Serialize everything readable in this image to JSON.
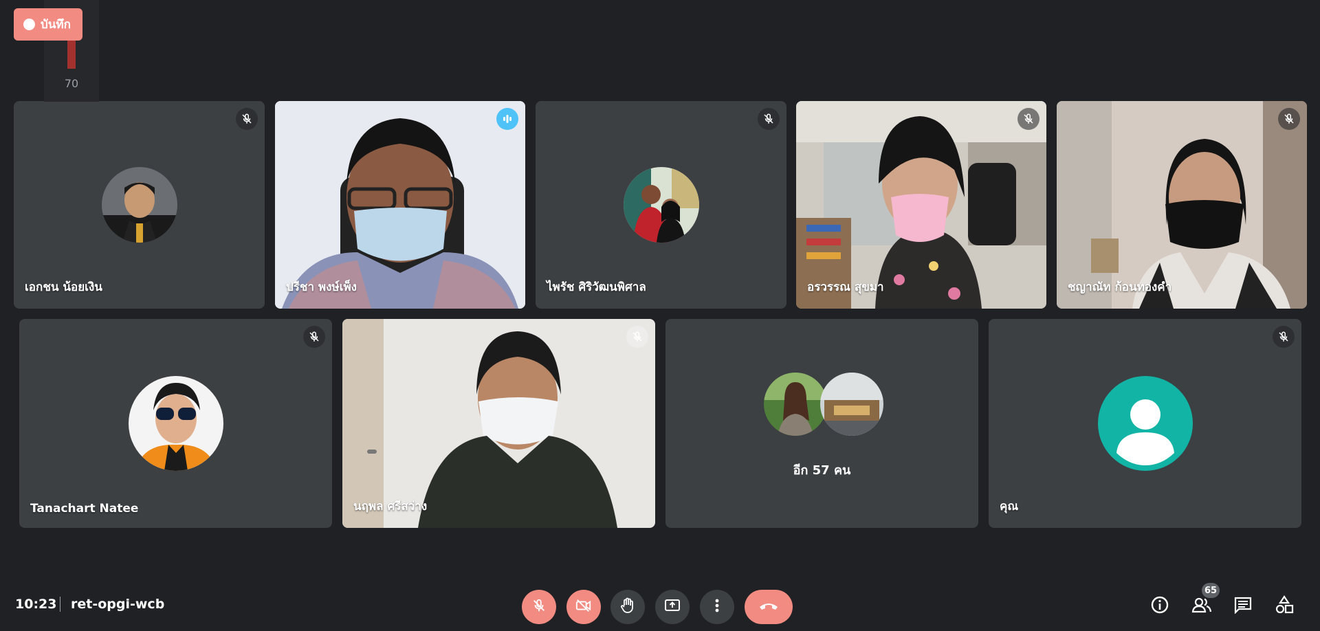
{
  "recording": {
    "label": "บันทึก"
  },
  "level_meter": {
    "value": "70"
  },
  "tiles": [
    {
      "name": "เอกชน น้อยเงิน"
    },
    {
      "name": "ปรีชา พงษ์เพ็ง"
    },
    {
      "name": "ไพรัช ศิริวัฒนพิศาล"
    },
    {
      "name": "อรวรรณ สุขมา"
    },
    {
      "name": "ชญาณัท ก้อนทองคำ"
    },
    {
      "name": "Tanachart Natee"
    },
    {
      "name": "นฤพล ศรีสว่าง"
    },
    {
      "name": "อีก 57 คน"
    },
    {
      "name": "คุณ"
    }
  ],
  "meeting": {
    "time": "10:23",
    "code": "ret-opgi-wcb"
  },
  "controls": {
    "mic": "mic-off-icon",
    "camera": "camera-off-icon",
    "hand": "raise-hand-icon",
    "present": "present-screen-icon",
    "more": "more-options-icon",
    "leave": "end-call-icon"
  },
  "participants_count": "65",
  "colors": {
    "background": "#202124",
    "tile": "#3c4043",
    "red": "#f28b82",
    "accent": "#8ab4f8",
    "teal": "#12b5a5"
  }
}
